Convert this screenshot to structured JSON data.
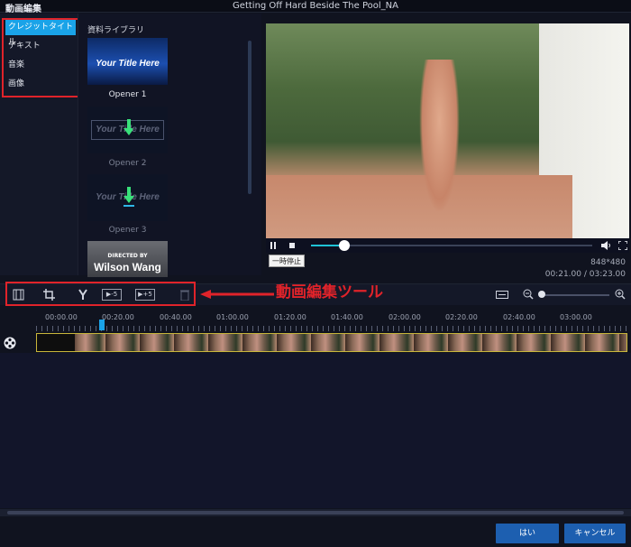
{
  "window": {
    "app_title": "動画編集",
    "file_title": "Getting Off Hard Beside The Pool_NA"
  },
  "categories": [
    {
      "label": "クレジットタイトル",
      "active": true
    },
    {
      "label": "テキスト",
      "active": false
    },
    {
      "label": "音楽",
      "active": false
    },
    {
      "label": "画像",
      "active": false
    }
  ],
  "library": {
    "title": "資料ライブラリ",
    "items": [
      {
        "label": "Opener 1",
        "text": "Your Title Here"
      },
      {
        "label": "Opener 2",
        "text": "Your Title Here"
      },
      {
        "label": "Opener 3",
        "text": "Your Title Here"
      },
      {
        "label": "",
        "directed": "DIRECTED BY",
        "name": "Wilson Wang"
      }
    ]
  },
  "player": {
    "tooltip": "一時停止",
    "resolution": "848*480",
    "timecode": "00:21.00 / 03:23.00",
    "progress": 0.12
  },
  "toolbar": {
    "annotation": "動画編集ツール",
    "speed_down": "▶-5",
    "speed_up": "▶+5"
  },
  "timeline": {
    "ticks": [
      "00:00.00",
      "00:20.00",
      "00:40.00",
      "01:00.00",
      "01:20.00",
      "01:40.00",
      "02:00.00",
      "02:20.00",
      "02:40.00",
      "03:00.00"
    ]
  },
  "footer": {
    "ok": "はい",
    "cancel": "キャンセル"
  },
  "colors": {
    "accent": "#1aa3e8",
    "annotation_red": "#e0232a",
    "button_blue": "#1d5fb0"
  }
}
